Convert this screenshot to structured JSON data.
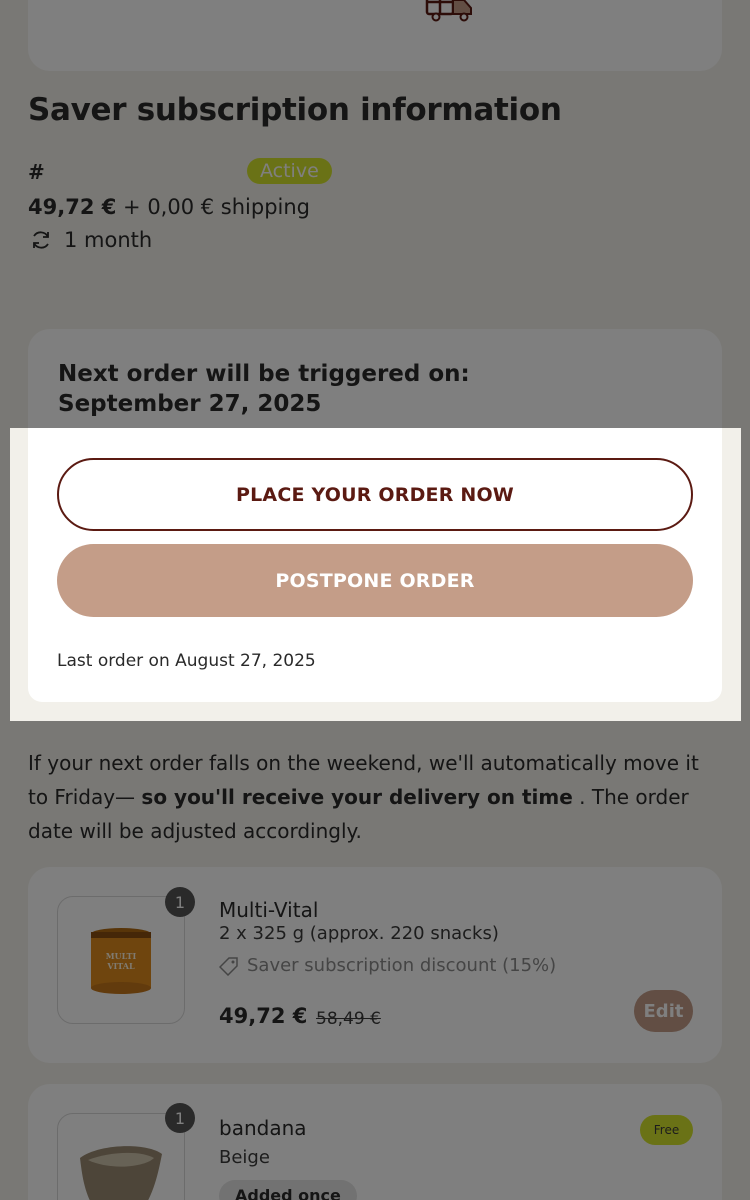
{
  "subscription": {
    "title": "Saver subscription information",
    "hash": "#",
    "status": "Active",
    "price": "49,72 €",
    "shipping": "+ 0,00 € shipping",
    "interval": "1 month"
  },
  "schedule": {
    "next_label": "Next order will be triggered on:",
    "next_date": "September 27, 2025",
    "place_order_label": "PLACE YOUR ORDER NOW",
    "postpone_label": "POSTPONE ORDER",
    "last_order": "Last order on August 27, 2025"
  },
  "note": {
    "part1": "If your next order falls on the weekend, we'll automatically move it to Friday— ",
    "bold": "so you'll receive your delivery on time",
    "part2": " . The order date will be adjusted accordingly."
  },
  "products": [
    {
      "qty": "1",
      "name": "Multi-Vital",
      "desc": "2 x 325 g (approx. 220 snacks)",
      "discount": "Saver subscription discount (15%)",
      "price": "49,72 €",
      "old_price": "58,49 €",
      "edit_label": "Edit",
      "label_line1": "MULTI",
      "label_line2": "VITAL"
    },
    {
      "qty": "1",
      "name": "bandana",
      "variant": "Beige",
      "added": "Added once",
      "badge": "Free"
    }
  ],
  "colors": {
    "accent_dark": "#5b1a12",
    "accent_brown": "#c49d88",
    "badge_lime": "#d5e42d",
    "background": "#f2f0ea"
  },
  "icons": {
    "delivery": "gift-truck-icon",
    "interval": "refresh-icon",
    "discount": "tag-icon"
  }
}
